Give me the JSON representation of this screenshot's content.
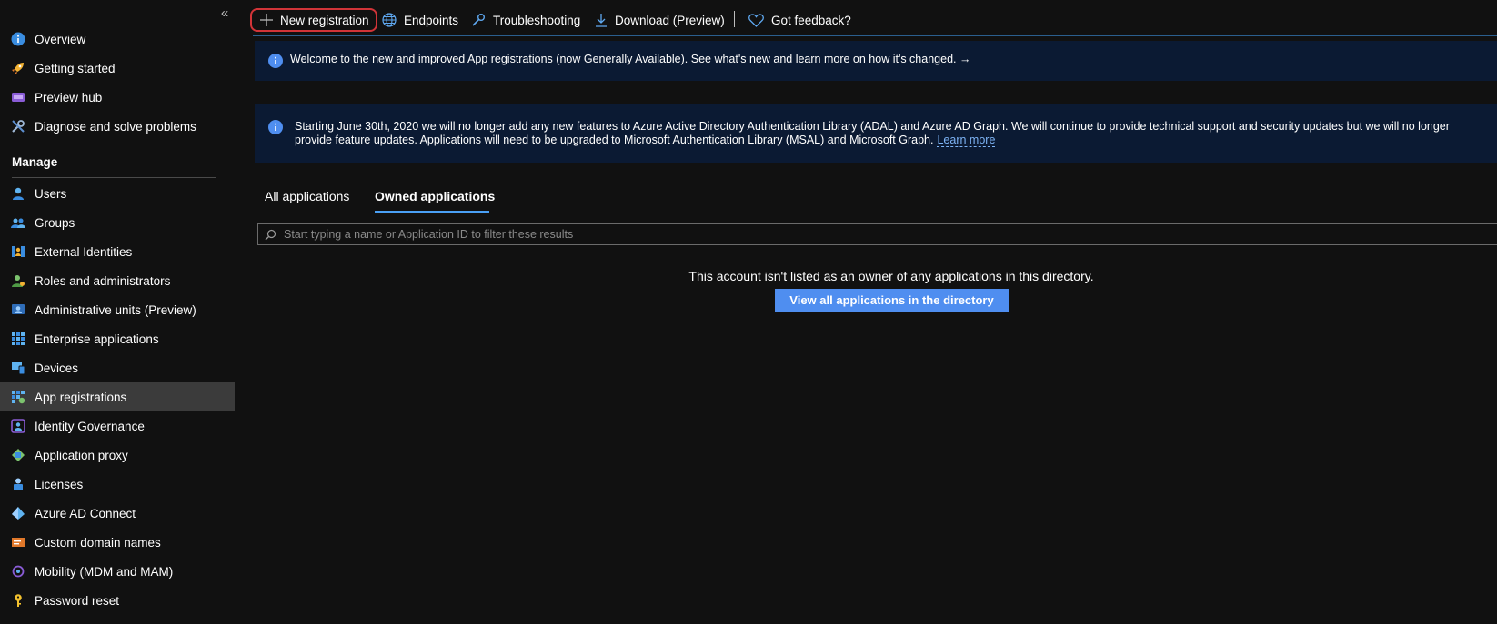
{
  "sidebar": {
    "collapse_glyph": "«",
    "section_manage": "Manage",
    "items": [
      {
        "label": "Overview",
        "icon": "info-icon"
      },
      {
        "label": "Getting started",
        "icon": "rocket-icon"
      },
      {
        "label": "Preview hub",
        "icon": "preview-hub-icon"
      },
      {
        "label": "Diagnose and solve problems",
        "icon": "wrench-icon"
      },
      {
        "label": "Users",
        "icon": "user-icon"
      },
      {
        "label": "Groups",
        "icon": "groups-icon"
      },
      {
        "label": "External Identities",
        "icon": "external-identities-icon"
      },
      {
        "label": "Roles and administrators",
        "icon": "roles-icon"
      },
      {
        "label": "Administrative units (Preview)",
        "icon": "admin-units-icon"
      },
      {
        "label": "Enterprise applications",
        "icon": "enterprise-apps-icon"
      },
      {
        "label": "Devices",
        "icon": "devices-icon"
      },
      {
        "label": "App registrations",
        "icon": "app-registrations-icon",
        "active": true
      },
      {
        "label": "Identity Governance",
        "icon": "identity-governance-icon"
      },
      {
        "label": "Application proxy",
        "icon": "app-proxy-icon"
      },
      {
        "label": "Licenses",
        "icon": "licenses-icon"
      },
      {
        "label": "Azure AD Connect",
        "icon": "azure-ad-connect-icon"
      },
      {
        "label": "Custom domain names",
        "icon": "custom-domain-icon"
      },
      {
        "label": "Mobility (MDM and MAM)",
        "icon": "mobility-icon"
      },
      {
        "label": "Password reset",
        "icon": "key-icon"
      }
    ]
  },
  "toolbar": {
    "new_registration": "New registration",
    "endpoints": "Endpoints",
    "troubleshooting": "Troubleshooting",
    "download": "Download (Preview)",
    "feedback": "Got feedback?"
  },
  "banners": {
    "welcome": "Welcome to the new and improved App registrations (now Generally Available). See what's new and learn more on how it's changed. →",
    "adal_notice": "Starting June 30th, 2020 we will no longer add any new features to Azure Active Directory Authentication Library (ADAL) and Azure AD Graph. We will continue to provide technical support and security updates but we will no longer provide feature updates. Applications will need to be upgraded to Microsoft Authentication Library (MSAL) and Microsoft Graph.",
    "learn_more": "Learn more"
  },
  "tabs": {
    "all": "All applications",
    "owned": "Owned applications",
    "active": "owned"
  },
  "search": {
    "placeholder": "Start typing a name or Application ID to filter these results",
    "value": ""
  },
  "empty_state": {
    "message": "This account isn't listed as an owner of any applications in this directory.",
    "button": "View all applications in the directory"
  },
  "colors": {
    "background": "#111111",
    "banner": "#0b1a33",
    "accent": "#4aa0f5",
    "primary_button": "#4f8ef0",
    "highlight_outline": "#d13438",
    "active_nav": "#3b3b3b"
  }
}
